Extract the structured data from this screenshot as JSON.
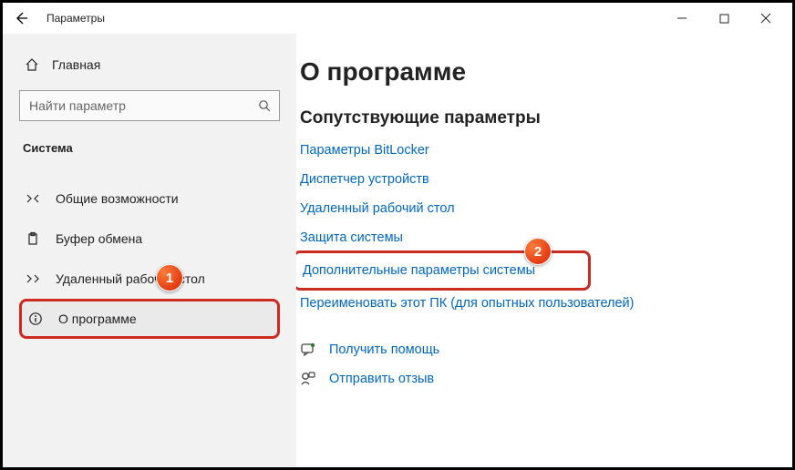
{
  "titlebar": {
    "title": "Параметры"
  },
  "sidebar": {
    "home": "Главная",
    "search_placeholder": "Найти параметр",
    "section": "Система",
    "items": [
      {
        "label": "Общие возможности"
      },
      {
        "label": "Буфер обмена"
      },
      {
        "label": "Удаленный рабочий стол"
      },
      {
        "label": "О программе"
      }
    ]
  },
  "main": {
    "heading": "О программе",
    "subheading": "Сопутствующие параметры",
    "links": [
      "Параметры BitLocker",
      "Диспетчер устройств",
      "Удаленный рабочий стол",
      "Защита системы",
      "Дополнительные параметры системы",
      "Переименовать этот ПК (для опытных пользователей)"
    ],
    "footer": {
      "help": "Получить помощь",
      "feedback": "Отправить отзыв"
    }
  },
  "annotations": {
    "badge1": "1",
    "badge2": "2"
  }
}
